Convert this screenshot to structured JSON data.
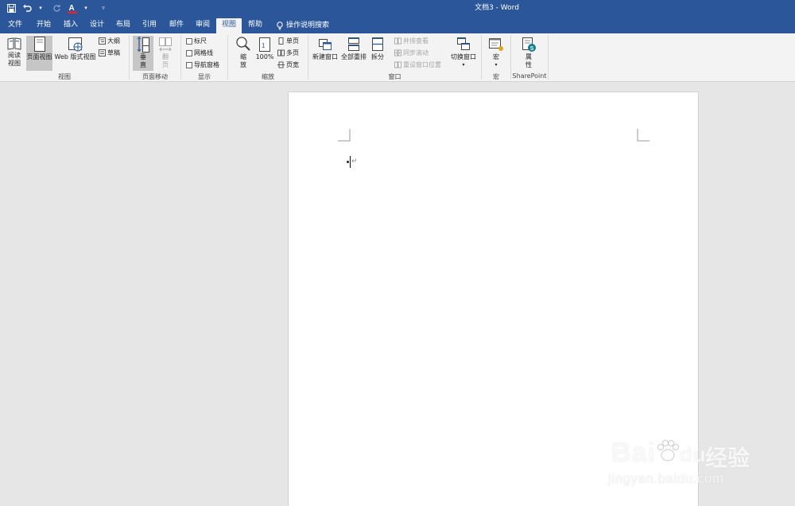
{
  "window": {
    "title": "文档3  -  Word"
  },
  "qat": {
    "save_icon": "save-icon",
    "undo_icon": "undo-icon",
    "redo_icon": "redo-icon",
    "font_color_icon": "font-color-icon"
  },
  "tabs": [
    {
      "label": "文件"
    },
    {
      "label": "开始"
    },
    {
      "label": "插入"
    },
    {
      "label": "设计"
    },
    {
      "label": "布局"
    },
    {
      "label": "引用"
    },
    {
      "label": "邮件"
    },
    {
      "label": "审阅"
    },
    {
      "label": "视图"
    },
    {
      "label": "帮助"
    }
  ],
  "tell_me": {
    "label": "操作说明搜索"
  },
  "ribbon": {
    "views": {
      "read_mode": "阅读\n视图",
      "print_layout": "页面视图",
      "web_layout": "Web 版式视图",
      "outline": "大纲",
      "draft": "草稿",
      "group_label": "视图"
    },
    "page_movement": {
      "vertical": "垂\n直",
      "side_to_side": "翻\n页",
      "group_label": "页面移动"
    },
    "show": {
      "ruler": "标尺",
      "gridlines": "网格线",
      "nav_pane": "导航窗格",
      "group_label": "显示"
    },
    "zoom": {
      "zoom": "缩\n放",
      "hundred": "100%",
      "one_page": "单页",
      "multi_page": "多页",
      "page_width": "页宽",
      "group_label": "缩放"
    },
    "window": {
      "new_window": "新建窗口",
      "arrange_all": "全部重排",
      "split": "拆分",
      "side_by_side": "并排查看",
      "sync_scroll": "同步滚动",
      "reset_pos": "重设窗口位置",
      "switch_windows": "切换窗口",
      "group_label": "窗口"
    },
    "macros": {
      "macros": "宏",
      "group_label": "宏"
    },
    "sharepoint": {
      "properties": "属\n性",
      "group_label": "SharePoint"
    }
  },
  "document": {
    "paragraph_mark": "↵"
  },
  "watermark": {
    "brand": "Bai",
    "brand2": "du",
    "cn": "经验",
    "url": "jingyan.baidu.com"
  },
  "colors": {
    "accent": "#2b579a",
    "ribbon_bg": "#f3f3f3",
    "canvas_bg": "#e6e6e6"
  }
}
